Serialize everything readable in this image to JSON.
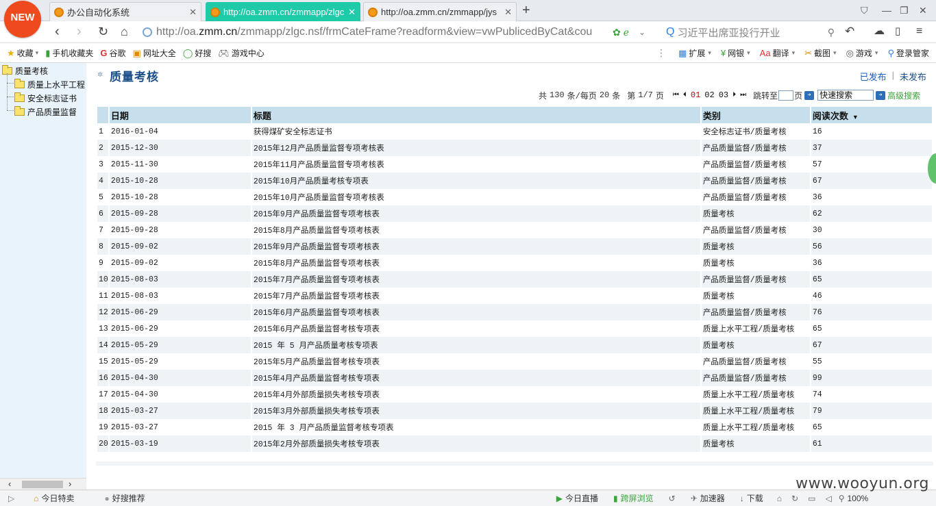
{
  "browser": {
    "new_badge": "NEW",
    "tabs": [
      {
        "label": "办公自动化系统",
        "active": false
      },
      {
        "label": "http://oa.zmm.cn/zmmapp/zlgc",
        "active": true
      },
      {
        "label": "http://oa.zmm.cn/zmmapp/jys",
        "active": false
      }
    ],
    "url_prefix": "http://oa.",
    "url_host": "zmm.cn",
    "url_rest": "/zmmapp/zlgc.nsf/frmCateFrame?readform&view=vwPublicedByCat&cou",
    "search_placeholder": "习近平出席亚投行开业"
  },
  "bookmarks": {
    "left": [
      {
        "label": "收藏",
        "icon": "star-icon"
      },
      {
        "label": "手机收藏夹",
        "icon": "phone-icon"
      },
      {
        "label": "谷歌",
        "icon": "google-icon"
      },
      {
        "label": "网址大全",
        "icon": "bookmark-icon"
      },
      {
        "label": "好搜",
        "icon": "search-icon"
      },
      {
        "label": "游戏中心",
        "icon": "gamepad-icon"
      }
    ],
    "right": [
      {
        "label": "扩展",
        "icon": "grid-icon"
      },
      {
        "label": "网银",
        "icon": "yen-icon"
      },
      {
        "label": "翻译",
        "icon": "translate-icon"
      },
      {
        "label": "截图",
        "icon": "screenshot-icon"
      },
      {
        "label": "游戏",
        "icon": "gamepad-icon"
      },
      {
        "label": "登录管家",
        "icon": "key-icon"
      }
    ]
  },
  "sidebar": {
    "root": "质量考核",
    "children": [
      "质量上水平工程",
      "安全标志证书",
      "产品质量监督"
    ]
  },
  "main": {
    "title": "质量考核",
    "published_link": "已发布",
    "unpublished_link": "未发布",
    "separator": "|",
    "pager": {
      "total_prefix": "共",
      "total": "130",
      "total_suffix": "条/每页",
      "per_page": "20",
      "per_page_suffix": "条",
      "page_prefix": "第",
      "page": "1/7",
      "page_suffix": "页",
      "pages": [
        "01",
        "02",
        "03"
      ],
      "jump_label": "跳转至",
      "jump_suffix": "页",
      "quick_search": "快速搜索",
      "advanced_search": "高级搜索"
    },
    "columns": [
      "日期",
      "标题",
      "类别",
      "阅读次数"
    ],
    "rows": [
      {
        "n": "1",
        "date": "2016-01-04",
        "title": "获得煤矿安全标志证书",
        "category": "安全标志证书/质量考核",
        "reads": "16"
      },
      {
        "n": "2",
        "date": "2015-12-30",
        "title": "2015年12月产品质量监督专项考核表",
        "category": "产品质量监督/质量考核",
        "reads": "37"
      },
      {
        "n": "3",
        "date": "2015-11-30",
        "title": "2015年11月产品质量监督专项考核表",
        "category": "产品质量监督/质量考核",
        "reads": "57"
      },
      {
        "n": "4",
        "date": "2015-10-28",
        "title": "2015年10月产品质量考核专项表",
        "category": "产品质量监督/质量考核",
        "reads": "67"
      },
      {
        "n": "5",
        "date": "2015-10-28",
        "title": "2015年10月产品质量监督专项考核表",
        "category": "产品质量监督/质量考核",
        "reads": "36"
      },
      {
        "n": "6",
        "date": "2015-09-28",
        "title": "2015年9月产品质量监督专项考核表",
        "category": "质量考核",
        "reads": "62"
      },
      {
        "n": "7",
        "date": "2015-09-28",
        "title": "2015年8月产品质量监督专项考核表",
        "category": "产品质量监督/质量考核",
        "reads": "30"
      },
      {
        "n": "8",
        "date": "2015-09-02",
        "title": "2015年9月产品质量监督专项考核表",
        "category": "质量考核",
        "reads": "56"
      },
      {
        "n": "9",
        "date": "2015-09-02",
        "title": "2015年8月产品质量监督专项考核表",
        "category": "质量考核",
        "reads": "36"
      },
      {
        "n": "10",
        "date": "2015-08-03",
        "title": "2015年7月产品质量监督专项考核表",
        "category": "产品质量监督/质量考核",
        "reads": "65"
      },
      {
        "n": "11",
        "date": "2015-08-03",
        "title": "2015年7月产品质量监督专项考核表",
        "category": "质量考核",
        "reads": "46"
      },
      {
        "n": "12",
        "date": "2015-06-29",
        "title": "2015年6月产品质量监督专项考核表",
        "category": "产品质量监督/质量考核",
        "reads": "76"
      },
      {
        "n": "13",
        "date": "2015-06-29",
        "title": "2015年6月产品质量监督考核专项表",
        "category": "质量上水平工程/质量考核",
        "reads": "65"
      },
      {
        "n": "14",
        "date": "2015-05-29",
        "title": "2015 年 5 月产品质量考核专项表",
        "category": "质量考核",
        "reads": "67"
      },
      {
        "n": "15",
        "date": "2015-05-29",
        "title": "2015年5月产品质量监督考核专项表",
        "category": "产品质量监督/质量考核",
        "reads": "55"
      },
      {
        "n": "16",
        "date": "2015-04-30",
        "title": "2015年4月产品质量监督考核专项表",
        "category": "产品质量监督/质量考核",
        "reads": "99"
      },
      {
        "n": "17",
        "date": "2015-04-30",
        "title": "2015年4月外部质量损失考核专项表",
        "category": "质量上水平工程/质量考核",
        "reads": "74"
      },
      {
        "n": "18",
        "date": "2015-03-27",
        "title": "2015年3月外部质量损失考核专项表",
        "category": "质量上水平工程/质量考核",
        "reads": "79"
      },
      {
        "n": "19",
        "date": "2015-03-27",
        "title": "2015 年 3 月产品质量监督考核专项表",
        "category": "质量上水平工程/质量考核",
        "reads": "65"
      },
      {
        "n": "20",
        "date": "2015-03-19",
        "title": "2015年2月外部质量损失考核专项表",
        "category": "质量考核",
        "reads": "61"
      }
    ]
  },
  "statusbar": {
    "today_deals": "今日特卖",
    "recommend": "好搜推荐",
    "live": "今日直播",
    "cross_screen": "跨屏浏览",
    "accelerator": "加速器",
    "download": "下载",
    "zoom": "100%"
  },
  "watermark": "www.wooyun.org"
}
